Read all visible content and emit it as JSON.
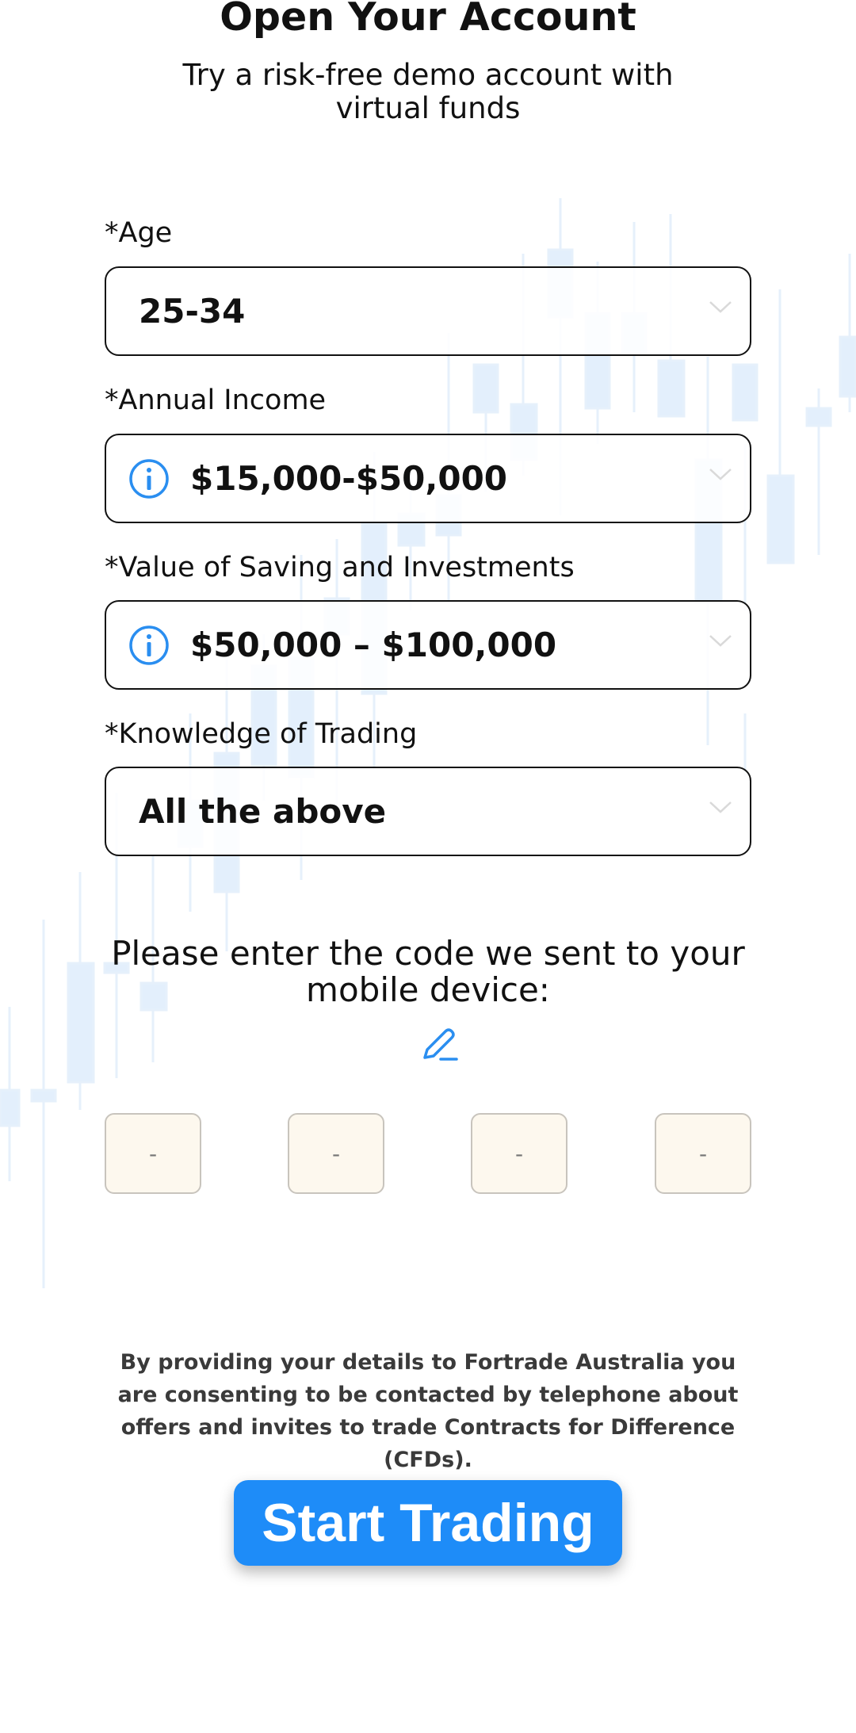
{
  "header": {
    "title": "Open Your Account",
    "subtitle": "Try a risk-free demo account with virtual funds"
  },
  "form": {
    "fields": [
      {
        "label": "*Age",
        "value": "25-34",
        "has_info_icon": false
      },
      {
        "label": "*Annual Income",
        "value": "$15,000-$50,000",
        "has_info_icon": true
      },
      {
        "label": "*Value of Saving and Investments",
        "value": "$50,000 – $100,000",
        "has_info_icon": true
      },
      {
        "label": "*Knowledge of Trading",
        "value": "All the above",
        "has_info_icon": false
      }
    ]
  },
  "verification": {
    "prompt": "Please enter the code we sent to your mobile device:",
    "edit_icon": "pencil-icon",
    "code_placeholders": [
      "-",
      "-",
      "-",
      "-"
    ]
  },
  "disclaimer": "By providing your details to Fortrade Australia you are consenting to be contacted by telephone about offers and invites to trade Contracts for Difference (CFDs).",
  "cta": {
    "label": "Start Trading"
  },
  "colors": {
    "accent": "#1e8cf8",
    "icon_blue": "#2a8ef0",
    "code_box_bg": "#fdf8ee",
    "background_chart": "#e3effc"
  },
  "icons": {
    "info": "info-circle-icon",
    "dropdown": "chevron-down-icon"
  }
}
